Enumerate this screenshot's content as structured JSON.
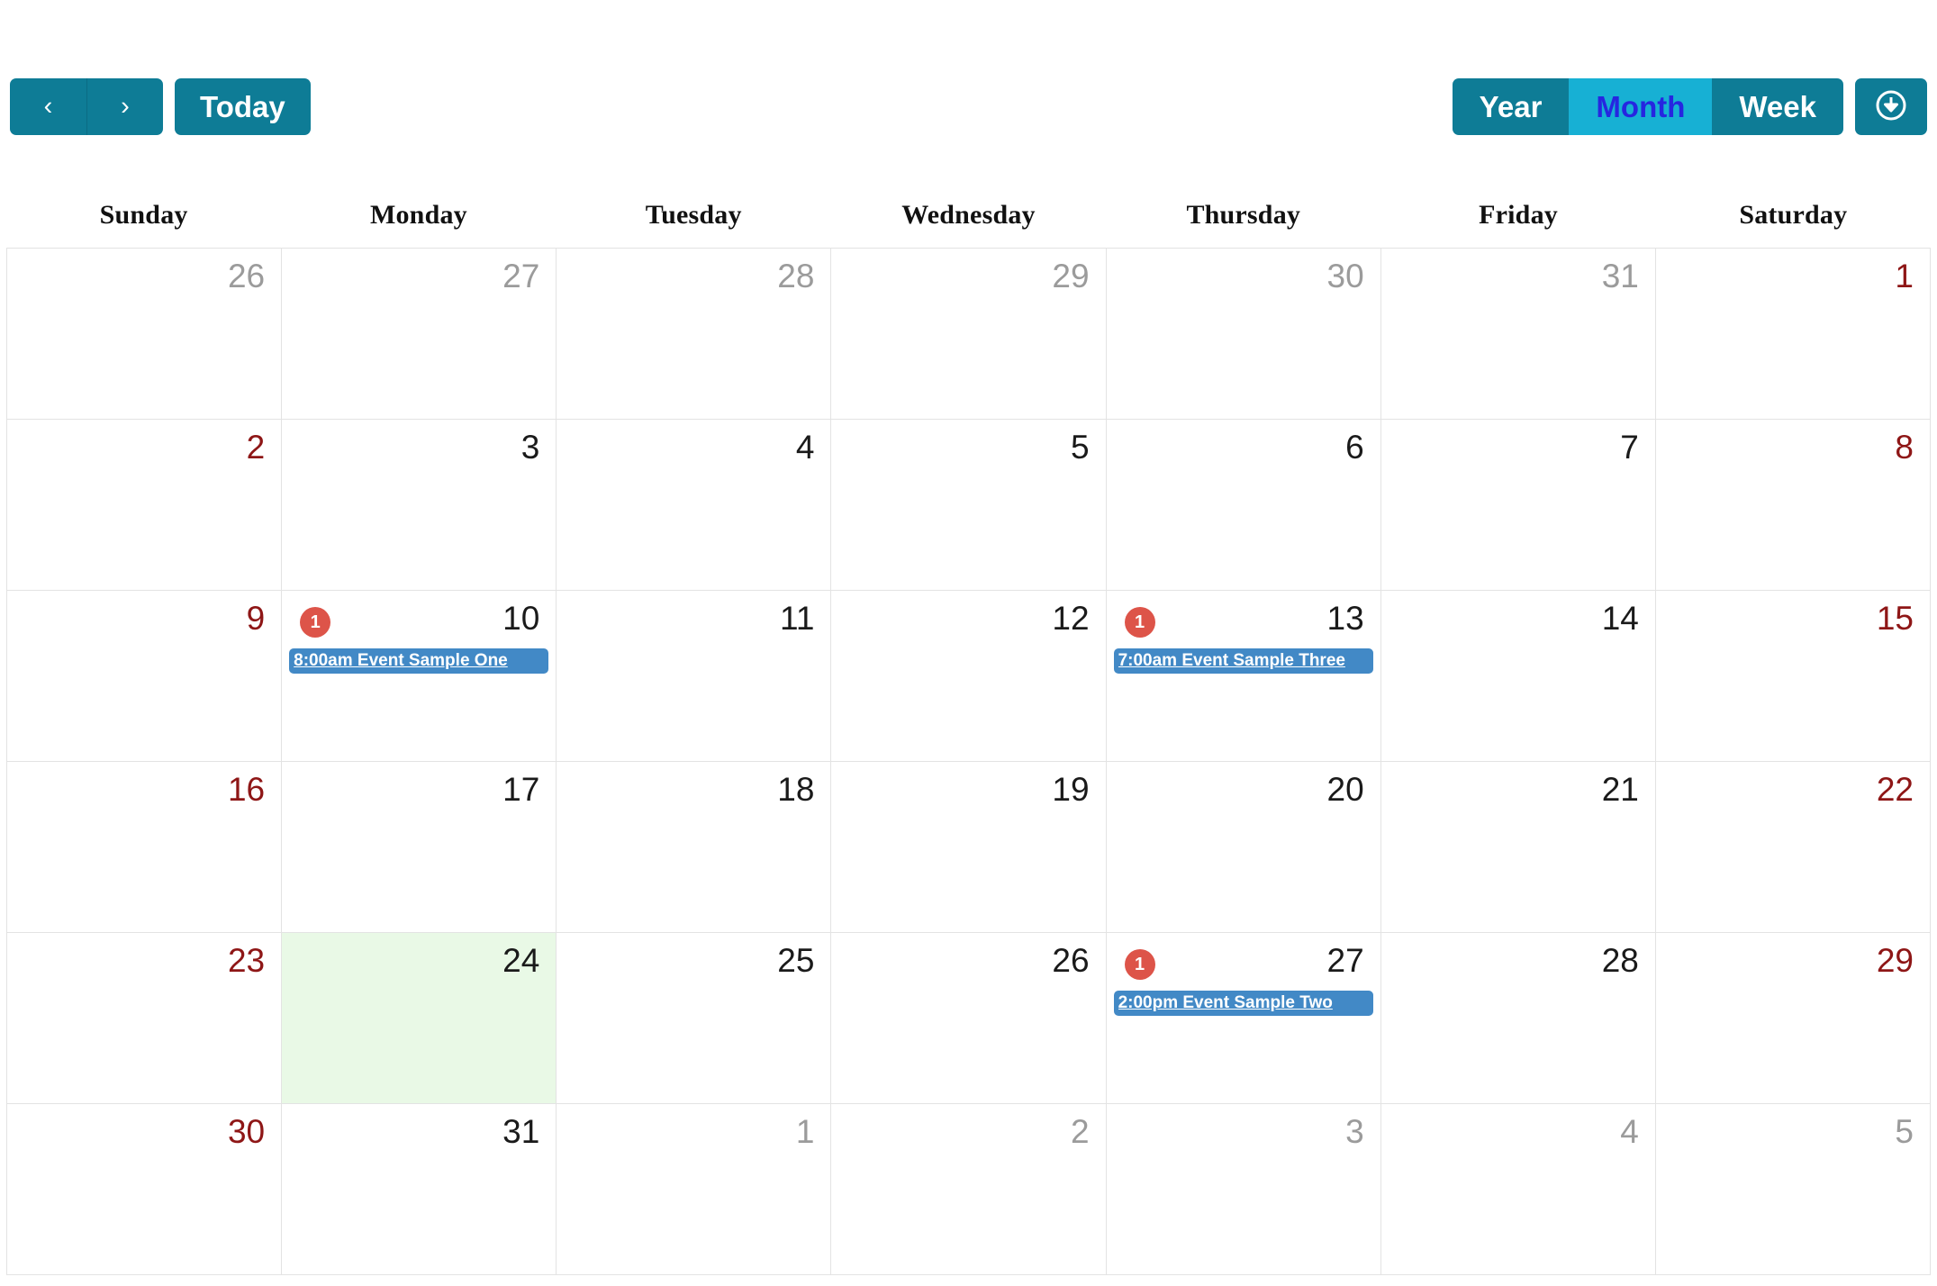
{
  "toolbar": {
    "prev_label": "‹",
    "next_label": "›",
    "today_label": "Today",
    "views": [
      {
        "label": "Year",
        "active": false
      },
      {
        "label": "Month",
        "active": true
      },
      {
        "label": "Week",
        "active": false
      }
    ],
    "download_icon": "download-circle-icon",
    "colors": {
      "button": "#0e7c96",
      "active_view_bg": "#17b0d4",
      "active_view_text": "#2626e0"
    }
  },
  "calendar": {
    "day_headers": [
      "Sunday",
      "Monday",
      "Tuesday",
      "Wednesday",
      "Thursday",
      "Friday",
      "Saturday"
    ],
    "colors": {
      "today_bg": "#e9f9e6",
      "weekend_text": "#8e1616",
      "other_month_text": "#9b9b9b",
      "badge_bg": "#dd5449",
      "event_bg": "#4289c6",
      "grid_line": "#e3e3e3"
    },
    "weeks": [
      [
        {
          "num": "26",
          "other": true,
          "weekend": true,
          "today": false,
          "badge": null,
          "event": null
        },
        {
          "num": "27",
          "other": true,
          "weekend": false,
          "today": false,
          "badge": null,
          "event": null
        },
        {
          "num": "28",
          "other": true,
          "weekend": false,
          "today": false,
          "badge": null,
          "event": null
        },
        {
          "num": "29",
          "other": true,
          "weekend": false,
          "today": false,
          "badge": null,
          "event": null
        },
        {
          "num": "30",
          "other": true,
          "weekend": false,
          "today": false,
          "badge": null,
          "event": null
        },
        {
          "num": "31",
          "other": true,
          "weekend": false,
          "today": false,
          "badge": null,
          "event": null
        },
        {
          "num": "1",
          "other": false,
          "weekend": true,
          "today": false,
          "badge": null,
          "event": null
        }
      ],
      [
        {
          "num": "2",
          "other": false,
          "weekend": true,
          "today": false,
          "badge": null,
          "event": null
        },
        {
          "num": "3",
          "other": false,
          "weekend": false,
          "today": false,
          "badge": null,
          "event": null
        },
        {
          "num": "4",
          "other": false,
          "weekend": false,
          "today": false,
          "badge": null,
          "event": null
        },
        {
          "num": "5",
          "other": false,
          "weekend": false,
          "today": false,
          "badge": null,
          "event": null
        },
        {
          "num": "6",
          "other": false,
          "weekend": false,
          "today": false,
          "badge": null,
          "event": null
        },
        {
          "num": "7",
          "other": false,
          "weekend": false,
          "today": false,
          "badge": null,
          "event": null
        },
        {
          "num": "8",
          "other": false,
          "weekend": true,
          "today": false,
          "badge": null,
          "event": null
        }
      ],
      [
        {
          "num": "9",
          "other": false,
          "weekend": true,
          "today": false,
          "badge": null,
          "event": null
        },
        {
          "num": "10",
          "other": false,
          "weekend": false,
          "today": false,
          "badge": "1",
          "event": "8:00am Event Sample One"
        },
        {
          "num": "11",
          "other": false,
          "weekend": false,
          "today": false,
          "badge": null,
          "event": null
        },
        {
          "num": "12",
          "other": false,
          "weekend": false,
          "today": false,
          "badge": null,
          "event": null
        },
        {
          "num": "13",
          "other": false,
          "weekend": false,
          "today": false,
          "badge": "1",
          "event": "7:00am Event Sample Three"
        },
        {
          "num": "14",
          "other": false,
          "weekend": false,
          "today": false,
          "badge": null,
          "event": null
        },
        {
          "num": "15",
          "other": false,
          "weekend": true,
          "today": false,
          "badge": null,
          "event": null
        }
      ],
      [
        {
          "num": "16",
          "other": false,
          "weekend": true,
          "today": false,
          "badge": null,
          "event": null
        },
        {
          "num": "17",
          "other": false,
          "weekend": false,
          "today": false,
          "badge": null,
          "event": null
        },
        {
          "num": "18",
          "other": false,
          "weekend": false,
          "today": false,
          "badge": null,
          "event": null
        },
        {
          "num": "19",
          "other": false,
          "weekend": false,
          "today": false,
          "badge": null,
          "event": null
        },
        {
          "num": "20",
          "other": false,
          "weekend": false,
          "today": false,
          "badge": null,
          "event": null
        },
        {
          "num": "21",
          "other": false,
          "weekend": false,
          "today": false,
          "badge": null,
          "event": null
        },
        {
          "num": "22",
          "other": false,
          "weekend": true,
          "today": false,
          "badge": null,
          "event": null
        }
      ],
      [
        {
          "num": "23",
          "other": false,
          "weekend": true,
          "today": false,
          "badge": null,
          "event": null
        },
        {
          "num": "24",
          "other": false,
          "weekend": false,
          "today": true,
          "badge": null,
          "event": null
        },
        {
          "num": "25",
          "other": false,
          "weekend": false,
          "today": false,
          "badge": null,
          "event": null
        },
        {
          "num": "26",
          "other": false,
          "weekend": false,
          "today": false,
          "badge": null,
          "event": null
        },
        {
          "num": "27",
          "other": false,
          "weekend": false,
          "today": false,
          "badge": "1",
          "event": "2:00pm Event Sample Two"
        },
        {
          "num": "28",
          "other": false,
          "weekend": false,
          "today": false,
          "badge": null,
          "event": null
        },
        {
          "num": "29",
          "other": false,
          "weekend": true,
          "today": false,
          "badge": null,
          "event": null
        }
      ],
      [
        {
          "num": "30",
          "other": false,
          "weekend": true,
          "today": false,
          "badge": null,
          "event": null
        },
        {
          "num": "31",
          "other": false,
          "weekend": false,
          "today": false,
          "badge": null,
          "event": null
        },
        {
          "num": "1",
          "other": true,
          "weekend": false,
          "today": false,
          "badge": null,
          "event": null
        },
        {
          "num": "2",
          "other": true,
          "weekend": false,
          "today": false,
          "badge": null,
          "event": null
        },
        {
          "num": "3",
          "other": true,
          "weekend": false,
          "today": false,
          "badge": null,
          "event": null
        },
        {
          "num": "4",
          "other": true,
          "weekend": false,
          "today": false,
          "badge": null,
          "event": null
        },
        {
          "num": "5",
          "other": true,
          "weekend": true,
          "today": false,
          "badge": null,
          "event": null
        }
      ]
    ]
  }
}
